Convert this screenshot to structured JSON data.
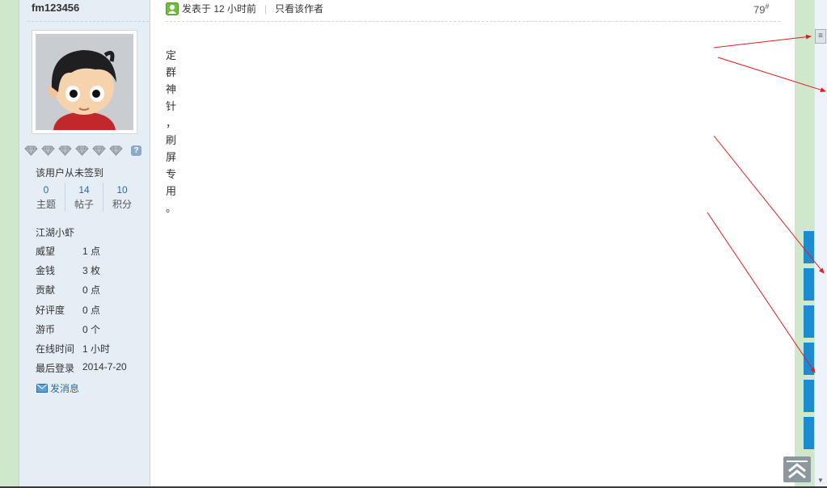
{
  "profile": {
    "username": "fm123456",
    "checkin": "该用户从未签到",
    "stats": [
      {
        "value": "0",
        "label": "主题"
      },
      {
        "value": "14",
        "label": "帖子"
      },
      {
        "value": "10",
        "label": "积分"
      }
    ],
    "rank": "江湖小虾",
    "info": [
      {
        "label": "威望",
        "value": "1 点"
      },
      {
        "label": "金钱",
        "value": "3 枚"
      },
      {
        "label": "贡献",
        "value": "0 点"
      },
      {
        "label": "好评度",
        "value": "0 点"
      },
      {
        "label": "游币",
        "value": "0 个"
      },
      {
        "label": "在线时间",
        "value": "1 小时"
      },
      {
        "label": "最后登录",
        "value": "2014-7-20"
      }
    ],
    "send_message": "发消息",
    "help_badge": "?"
  },
  "post": {
    "posted_at": "发表于 12 小时前",
    "separator": "|",
    "author_only": "只看该作者",
    "floor_number": "79",
    "floor_mark": "#",
    "body": [
      "定",
      "群",
      "神",
      "针",
      "，",
      "刷",
      "屏",
      "专",
      "用",
      "。"
    ]
  },
  "scrollbar": {
    "thumb_glyph": "≡",
    "down_glyph": "▼"
  },
  "icons": {
    "post_status": "user-green-icon",
    "medal": "diamond-medal-icon",
    "mail": "mail-icon",
    "back_to_top": "double-chevron-up-icon"
  },
  "colors": {
    "side_green": "#cfe8cc",
    "profile_bg": "#e6eef5",
    "link_blue": "#2d6aa0",
    "side_button_blue": "#1d8bd0",
    "arrow_red": "#e31b1b"
  }
}
